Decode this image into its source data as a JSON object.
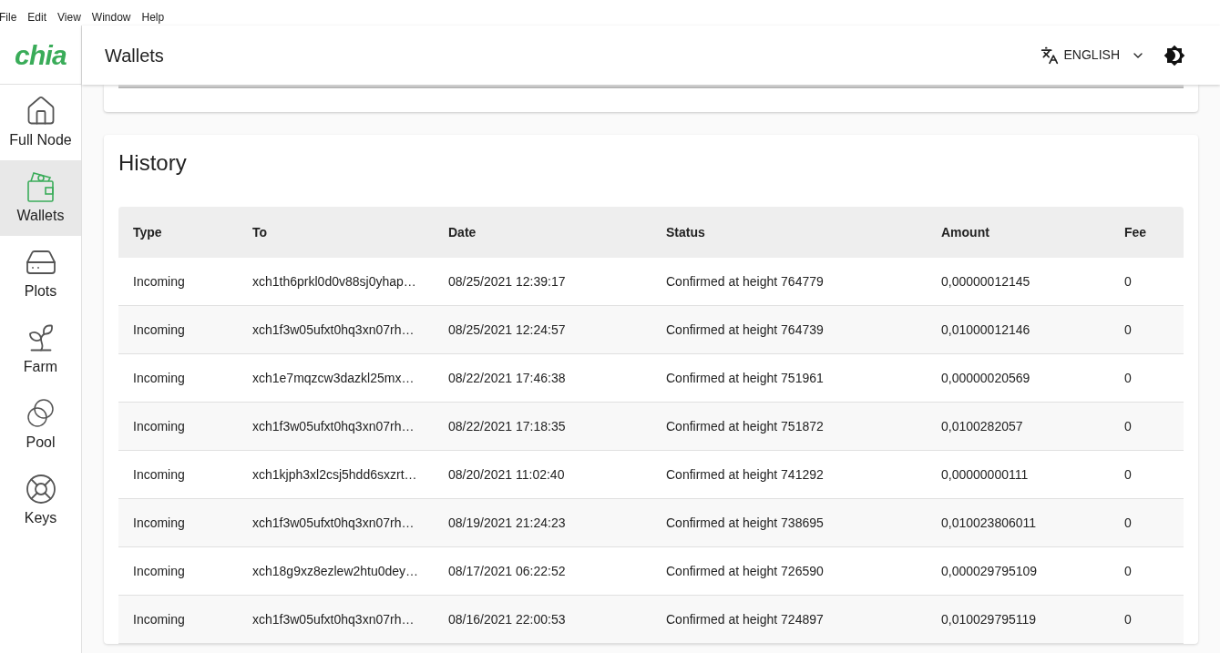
{
  "menu_bar": [
    "File",
    "Edit",
    "View",
    "Window",
    "Help"
  ],
  "logo": "chia",
  "header": {
    "title": "Wallets",
    "language": "ENGLISH"
  },
  "sidebar": {
    "items": [
      {
        "label": "Full Node",
        "selected": false
      },
      {
        "label": "Wallets",
        "selected": true
      },
      {
        "label": "Plots",
        "selected": false
      },
      {
        "label": "Farm",
        "selected": false
      },
      {
        "label": "Pool",
        "selected": false
      },
      {
        "label": "Keys",
        "selected": false
      }
    ]
  },
  "history": {
    "title": "History",
    "columns": [
      "Type",
      "To",
      "Date",
      "Status",
      "Amount",
      "Fee"
    ],
    "rows": [
      [
        "Incoming",
        "xch1th6prkl0d0v88sj0yhap…",
        "08/25/2021 12:39:17",
        "Confirmed at height 764779",
        "0,00000012145",
        "0"
      ],
      [
        "Incoming",
        "xch1f3w05ufxt0hq3xn07rh…",
        "08/25/2021 12:24:57",
        "Confirmed at height 764739",
        "0,01000012146",
        "0"
      ],
      [
        "Incoming",
        "xch1e7mqzcw3dazkl25mx…",
        "08/22/2021 17:46:38",
        "Confirmed at height 751961",
        "0,00000020569",
        "0"
      ],
      [
        "Incoming",
        "xch1f3w05ufxt0hq3xn07rh…",
        "08/22/2021 17:18:35",
        "Confirmed at height 751872",
        "0,0100282057",
        "0"
      ],
      [
        "Incoming",
        "xch1kjph3xl2csj5hdd6sxzrt…",
        "08/20/2021 11:02:40",
        "Confirmed at height 741292",
        "0,00000000111",
        "0"
      ],
      [
        "Incoming",
        "xch1f3w05ufxt0hq3xn07rh…",
        "08/19/2021 21:24:23",
        "Confirmed at height 738695",
        "0,010023806011",
        "0"
      ],
      [
        "Incoming",
        "xch18g9xz8ezlew2htu0dey…",
        "08/17/2021 06:22:52",
        "Confirmed at height 726590",
        "0,000029795109",
        "0"
      ],
      [
        "Incoming",
        "xch1f3w05ufxt0hq3xn07rh…",
        "08/16/2021 22:00:53",
        "Confirmed at height 724897",
        "0,010029795119",
        "0"
      ]
    ]
  }
}
